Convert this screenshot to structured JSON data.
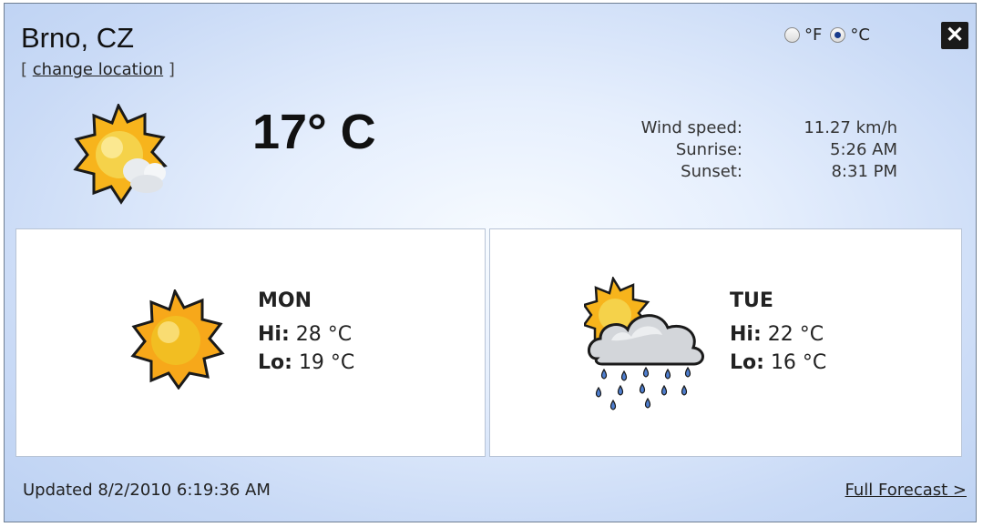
{
  "location": {
    "city": "Brno, CZ",
    "change_label": "change location",
    "bracket_open": "[",
    "bracket_close": "]"
  },
  "units": {
    "fahrenheit_label": "°F",
    "celsius_label": "°C",
    "selected": "celsius"
  },
  "close_label": "✕",
  "current": {
    "icon": "sun-cloud-icon",
    "temperature": "17° C",
    "details": [
      {
        "label": "Wind speed:",
        "value": "11.27 km/h"
      },
      {
        "label": "Sunrise:",
        "value": "5:26 AM"
      },
      {
        "label": "Sunset:",
        "value": "8:31 PM"
      }
    ]
  },
  "forecast": [
    {
      "day": "MON",
      "icon": "sun-icon",
      "hi_label": "Hi:",
      "hi": "28 °C",
      "lo_label": "Lo:",
      "lo": "19 °C"
    },
    {
      "day": "TUE",
      "icon": "rain-cloud-icon",
      "hi_label": "Hi:",
      "hi": "22 °C",
      "lo_label": "Lo:",
      "lo": "16 °C"
    }
  ],
  "footer": {
    "updated": "Updated 8/2/2010 6:19:36 AM",
    "full_forecast": "Full Forecast >"
  },
  "colors": {
    "sun": "#f7b41c",
    "sun_core": "#f5d24a",
    "cloud": "#c8ccd2",
    "rain": "#4f7fd0",
    "background": "#c9daf6"
  }
}
